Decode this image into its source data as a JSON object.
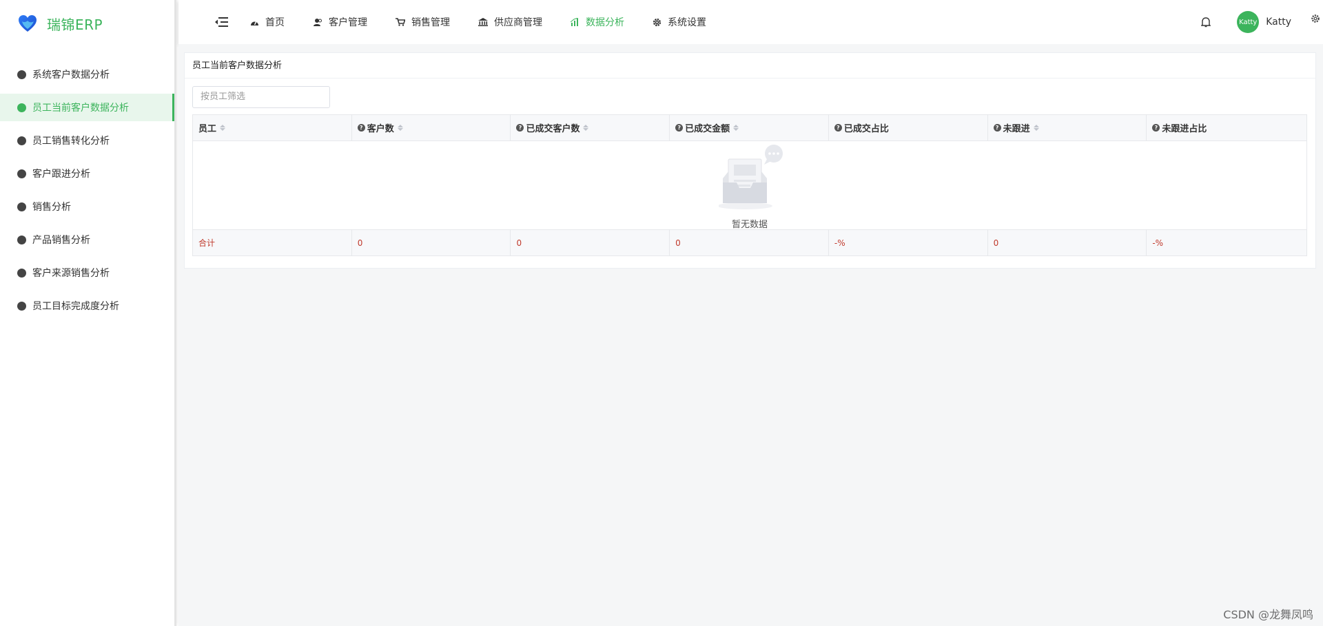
{
  "app": {
    "name": "瑞锦ERP",
    "brand_color": "#3cb45c"
  },
  "sidebar": {
    "items": [
      {
        "label": "系统客户数据分析",
        "icon": "pie-chart-icon",
        "active": false
      },
      {
        "label": "员工当前客户数据分析",
        "icon": "user-icon",
        "active": true
      },
      {
        "label": "员工销售转化分析",
        "icon": "user-icon",
        "active": false
      },
      {
        "label": "客户跟进分析",
        "icon": "user-follow-icon",
        "active": false
      },
      {
        "label": "销售分析",
        "icon": "bar-chart-icon",
        "active": false
      },
      {
        "label": "产品销售分析",
        "icon": "diamond-icon",
        "active": false
      },
      {
        "label": "客户来源销售分析",
        "icon": "bulb-icon",
        "active": false
      },
      {
        "label": "员工目标完成度分析",
        "icon": "badge-icon",
        "active": false
      }
    ]
  },
  "header": {
    "nav": [
      {
        "label": "首页",
        "icon": "dashboard-icon",
        "active": false
      },
      {
        "label": "客户管理",
        "icon": "users-icon",
        "active": false
      },
      {
        "label": "销售管理",
        "icon": "cart-icon",
        "active": false
      },
      {
        "label": "供应商管理",
        "icon": "bank-icon",
        "active": false
      },
      {
        "label": "数据分析",
        "icon": "bar-chart-icon",
        "active": true
      },
      {
        "label": "系统设置",
        "icon": "gear-icon",
        "active": false
      }
    ],
    "user": {
      "avatar_text": "Katty",
      "name": "Katty"
    }
  },
  "card": {
    "title": "员工当前客户数据分析",
    "filter_placeholder": "按员工筛选"
  },
  "table": {
    "columns": [
      {
        "label": "员工",
        "help": false,
        "sortable": true
      },
      {
        "label": "客户数",
        "help": true,
        "sortable": true
      },
      {
        "label": "已成交客户数",
        "help": true,
        "sortable": true
      },
      {
        "label": "已成交金额",
        "help": true,
        "sortable": true
      },
      {
        "label": "已成交占比",
        "help": true,
        "sortable": false
      },
      {
        "label": "未跟进",
        "help": true,
        "sortable": true
      },
      {
        "label": "未跟进占比",
        "help": true,
        "sortable": false
      }
    ],
    "empty_text": "暂无数据",
    "totals": [
      "合计",
      "0",
      "0",
      "0",
      "-%",
      "0",
      "-%"
    ]
  },
  "watermark": "CSDN @龙舞凤鸣"
}
